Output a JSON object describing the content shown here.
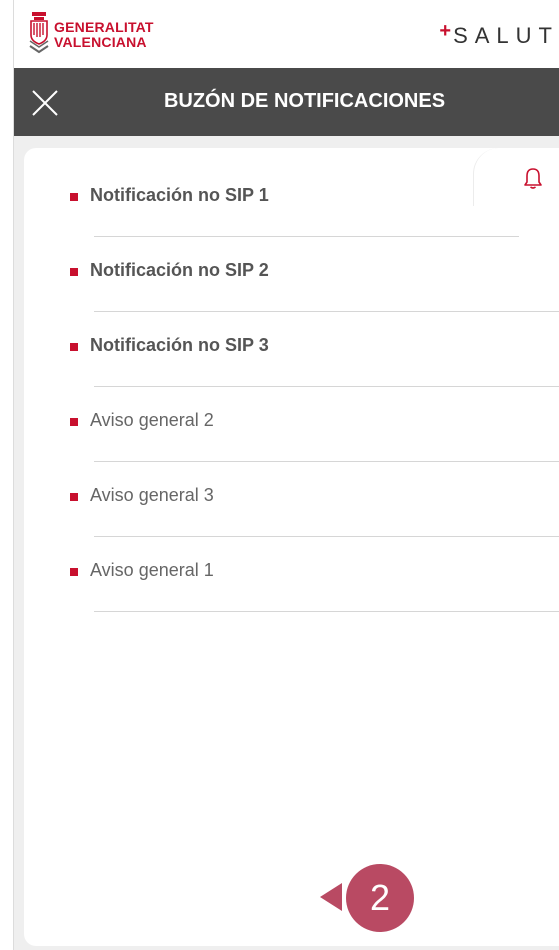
{
  "header": {
    "logo_line1": "GENERALITAT",
    "logo_line2": "VALENCIANA",
    "brand_plus": "+",
    "brand_name": "SALUT"
  },
  "titlebar": {
    "close_icon": "close-icon",
    "title": "BUZÓN DE NOTIFICACIONES"
  },
  "tab": {
    "icon": "bell-icon"
  },
  "notifications": [
    {
      "label": "Notificación no SIP 1",
      "unread": true
    },
    {
      "label": "Notificación no SIP 2",
      "unread": true
    },
    {
      "label": "Notificación no SIP 3",
      "unread": true
    },
    {
      "label": "Aviso general 2",
      "unread": false
    },
    {
      "label": "Aviso general 3",
      "unread": false
    },
    {
      "label": "Aviso general 1",
      "unread": false
    }
  ],
  "callout": {
    "number": "2"
  },
  "colors": {
    "accent": "#c8102e",
    "titlebar": "#4a4a4a",
    "callout": "#b94a63",
    "background": "#efefef"
  }
}
